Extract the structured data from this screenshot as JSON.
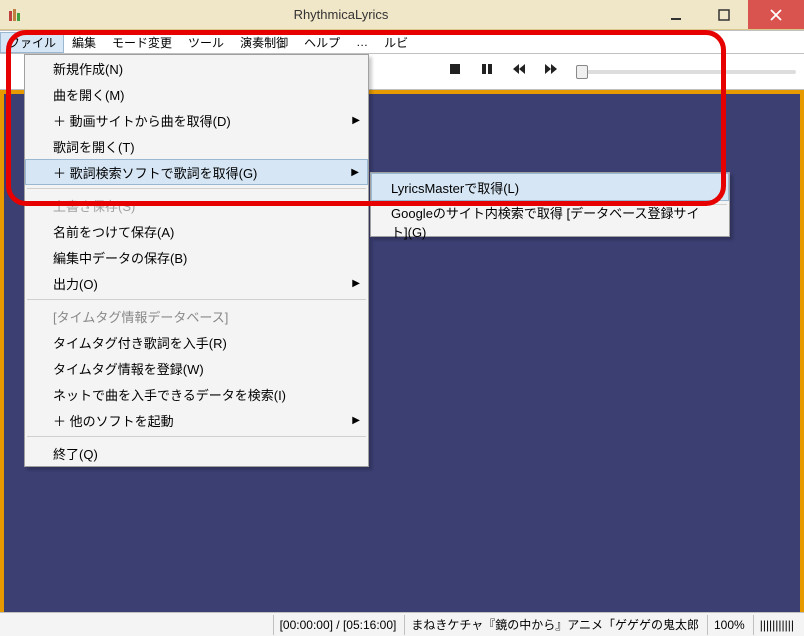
{
  "title": "RhythmicaLyrics",
  "menubar": {
    "file": "ファイル",
    "edit": "編集",
    "mode": "モード変更",
    "tools": "ツール",
    "play": "演奏制御",
    "help": "ヘルプ",
    "more": "…",
    "ruby": "ルビ"
  },
  "file_menu": {
    "new": "新規作成(N)",
    "open_song": "曲を開く(M)",
    "get_from_video": "＋ 動画サイトから曲を取得(D)",
    "open_lyrics": "歌詞を開く(T)",
    "get_lyrics_soft": "＋ 歌詞検索ソフトで歌詞を取得(G)",
    "overwrite_save": "上書き保存(S)",
    "save_as": "名前をつけて保存(A)",
    "save_editing": "編集中データの保存(B)",
    "output": "出力(O)",
    "timetag_db_header": "[タイムタグ情報データベース]",
    "get_timetag_lyrics": "タイムタグ付き歌詞を入手(R)",
    "register_timetag": "タイムタグ情報を登録(W)",
    "search_net": "ネットで曲を入手できるデータを検索(I)",
    "launch_other": "＋ 他のソフトを起動",
    "exit": "終了(Q)"
  },
  "submenu": {
    "lyricsmaster": "LyricsMasterで取得(L)",
    "google_site": "Googleのサイト内検索で取得 [データベース登録サイト](G)"
  },
  "status": {
    "time": "[00:00:00] / [05:16:00]",
    "info": "まねきケチャ『鏡の中から』アニメ「ゲゲゲの鬼太郎",
    "zoom": "100%",
    "bars": "|||||||||||"
  }
}
